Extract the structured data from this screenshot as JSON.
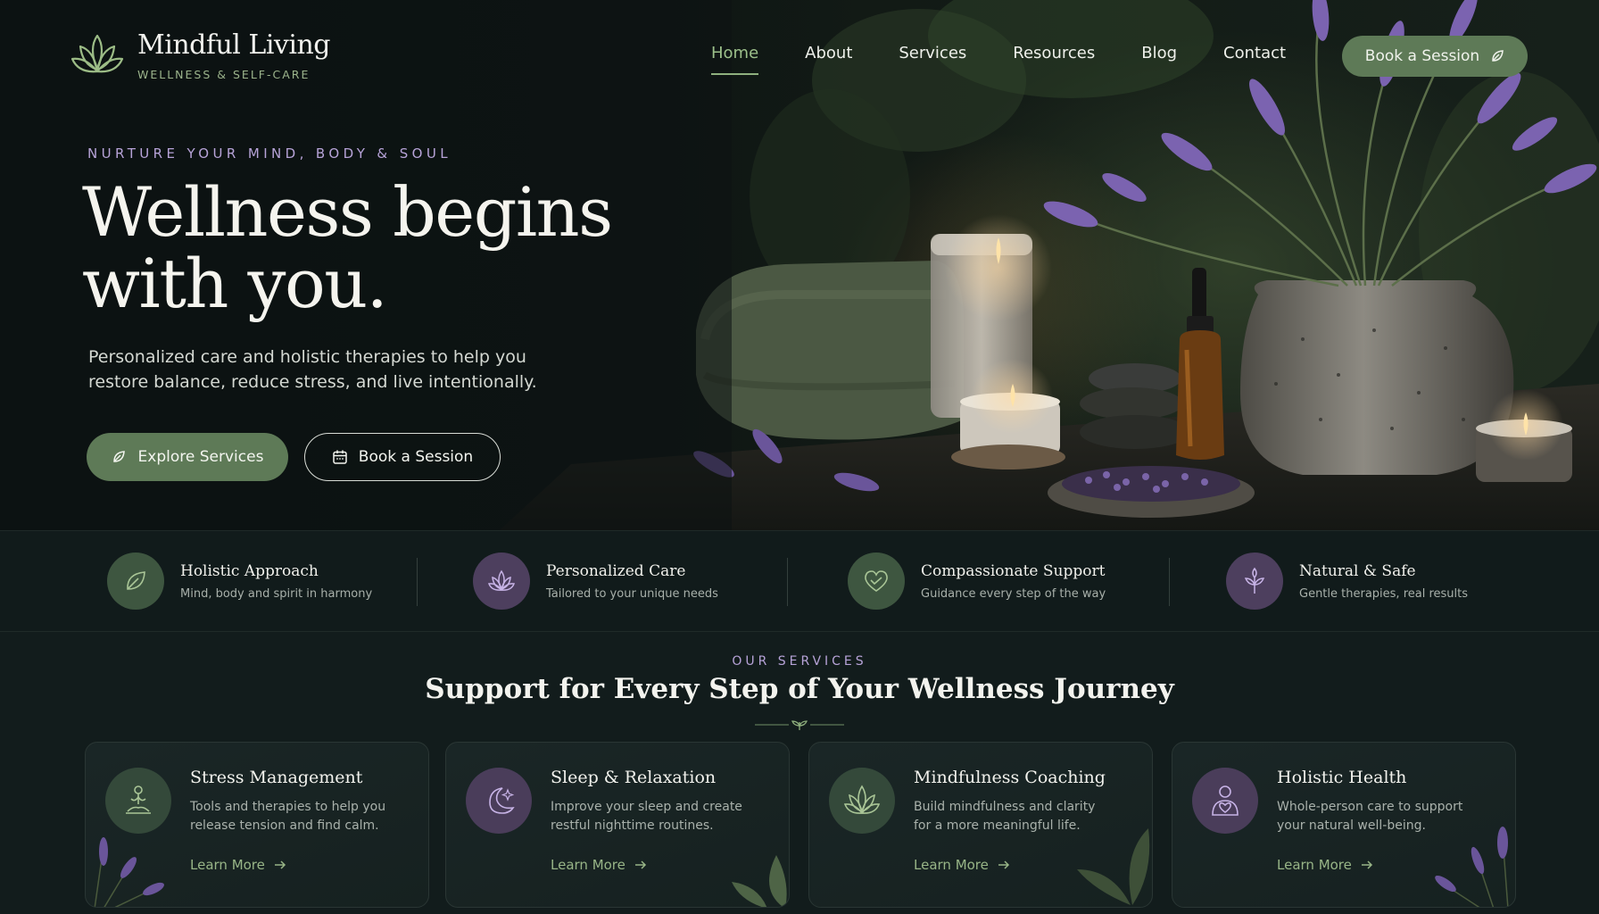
{
  "brand": {
    "name": "Mindful Living",
    "tagline": "WELLNESS & SELF-CARE"
  },
  "nav": {
    "items": [
      "Home",
      "About",
      "Services",
      "Resources",
      "Blog",
      "Contact"
    ],
    "active": "Home",
    "cta_label": "Book a Session"
  },
  "hero": {
    "eyebrow": "NURTURE YOUR MIND, BODY & SOUL",
    "headline_line1": "Wellness begins",
    "headline_line2": "with you.",
    "subcopy_line1": "Personalized care and holistic therapies to help you",
    "subcopy_line2": "restore balance, reduce stress, and live intentionally.",
    "primary_button": "Explore Services",
    "secondary_button": "Book a Session"
  },
  "features": [
    {
      "title": "Holistic Approach",
      "subtitle": "Mind, body and spirit in harmony",
      "icon": "leaf-icon"
    },
    {
      "title": "Personalized Care",
      "subtitle": "Tailored to your unique needs",
      "icon": "lotus-icon"
    },
    {
      "title": "Compassionate Support",
      "subtitle": "Guidance every step of the way",
      "icon": "heart-icon"
    },
    {
      "title": "Natural & Safe",
      "subtitle": "Gentle therapies, real results",
      "icon": "sprout-icon"
    }
  ],
  "services": {
    "eyebrow": "OUR SERVICES",
    "title": "Support for Every Step of Your Wellness Journey",
    "cards": [
      {
        "title": "Stress Management",
        "desc_line1": "Tools and therapies to help you",
        "desc_line2": "release tension and find calm.",
        "link": "Learn More",
        "icon": "meditation-icon"
      },
      {
        "title": "Sleep & Relaxation",
        "desc_line1": "Improve your sleep and create",
        "desc_line2": "restful nighttime routines.",
        "link": "Learn More",
        "icon": "moon-icon"
      },
      {
        "title": "Mindfulness Coaching",
        "desc_line1": "Build mindfulness and clarity",
        "desc_line2": "for a more meaningful life.",
        "link": "Learn More",
        "icon": "lotus-icon"
      },
      {
        "title": "Holistic Health",
        "desc_line1": "Whole-person care to support",
        "desc_line2": "your natural well-being.",
        "link": "Learn More",
        "icon": "person-heart-icon"
      }
    ]
  },
  "colors": {
    "accent_green": "#5e7a57",
    "accent_purple": "#b7a3d8",
    "background": "#0d1414"
  }
}
